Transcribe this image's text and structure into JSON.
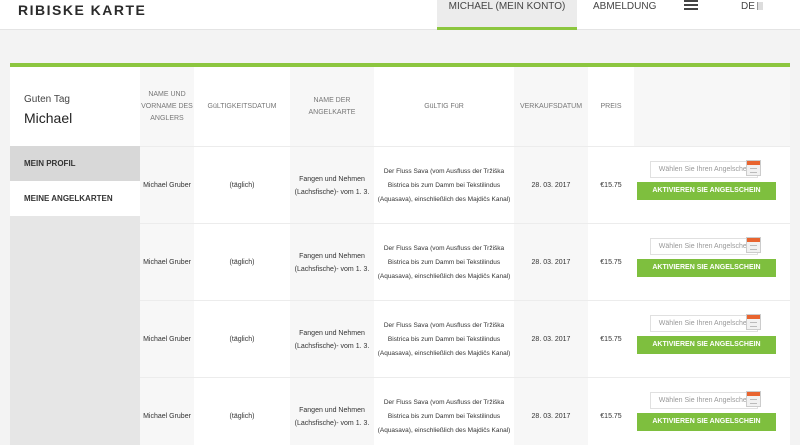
{
  "header": {
    "logo": "RIBISKE KARTE",
    "account_label": "MICHAEL (MEIN KONTO)",
    "logout_label": "ABMELDUNG",
    "lang_label": "DE",
    "menu_icon": "hamburger-menu-icon",
    "accent_color": "#8cc63f"
  },
  "greeting": {
    "small": "Guten Tag",
    "name": "Michael"
  },
  "sidebar": {
    "items": [
      {
        "label": "MEIN PROFIL"
      },
      {
        "label": "MEINE ANGELKARTEN"
      }
    ]
  },
  "table": {
    "headers": {
      "name": "NAME UND VORNAME DES ANGLERS",
      "valid_date": "GüLTIGKEITSDATUM",
      "card": "NAME DER ANGELKARTE",
      "valid_for": "GüLTIG FüR",
      "sale_date": "VERKAUFSDATUM",
      "price": "PREIS"
    },
    "rows": [
      {
        "name": "Michael Gruber",
        "valid": "(täglich)",
        "card": "Fangen und Nehmen (Lachsfische)- vom 1. 3.",
        "region": "Der Fluss Sava (vom Ausfluss der Tržiška Bistrica bis zum Damm bei Tekstilindus (Aquasava), einschließlich des Majdičs Kanal)",
        "sale_date": "28. 03. 2017",
        "price": "€15.75",
        "date_placeholder": "Wählen Sie Ihren Angelschein",
        "button": "AKTIVIEREN SIE ANGELSCHEIN"
      },
      {
        "name": "Michael Gruber",
        "valid": "(täglich)",
        "card": "Fangen und Nehmen (Lachsfische)- vom 1. 3.",
        "region": "Der Fluss Sava (vom Ausfluss der Tržiška Bistrica bis zum Damm bei Tekstilindus (Aquasava), einschließlich des Majdičs Kanal)",
        "sale_date": "28. 03. 2017",
        "price": "€15.75",
        "date_placeholder": "Wählen Sie Ihren Angelschein",
        "button": "AKTIVIEREN SIE ANGELSCHEIN"
      },
      {
        "name": "Michael Gruber",
        "valid": "(täglich)",
        "card": "Fangen und Nehmen (Lachsfische)- vom 1. 3.",
        "region": "Der Fluss Sava (vom Ausfluss der Tržiška Bistrica bis zum Damm bei Tekstilindus (Aquasava), einschließlich des Majdičs Kanal)",
        "sale_date": "28. 03. 2017",
        "price": "€15.75",
        "date_placeholder": "Wählen Sie Ihren Angelschein",
        "button": "AKTIVIEREN SIE ANGELSCHEIN"
      },
      {
        "name": "Michael Gruber",
        "valid": "(täglich)",
        "card": "Fangen und Nehmen (Lachsfische)- vom 1. 3.",
        "region": "Der Fluss Sava (vom Ausfluss der Tržiška Bistrica bis zum Damm bei Tekstilindus (Aquasava), einschließlich des Majdičs Kanal)",
        "sale_date": "28. 03. 2017",
        "price": "€15.75",
        "date_placeholder": "Wählen Sie Ihren Angelschein",
        "button": "AKTIVIEREN SIE ANGELSCHEIN"
      }
    ]
  }
}
